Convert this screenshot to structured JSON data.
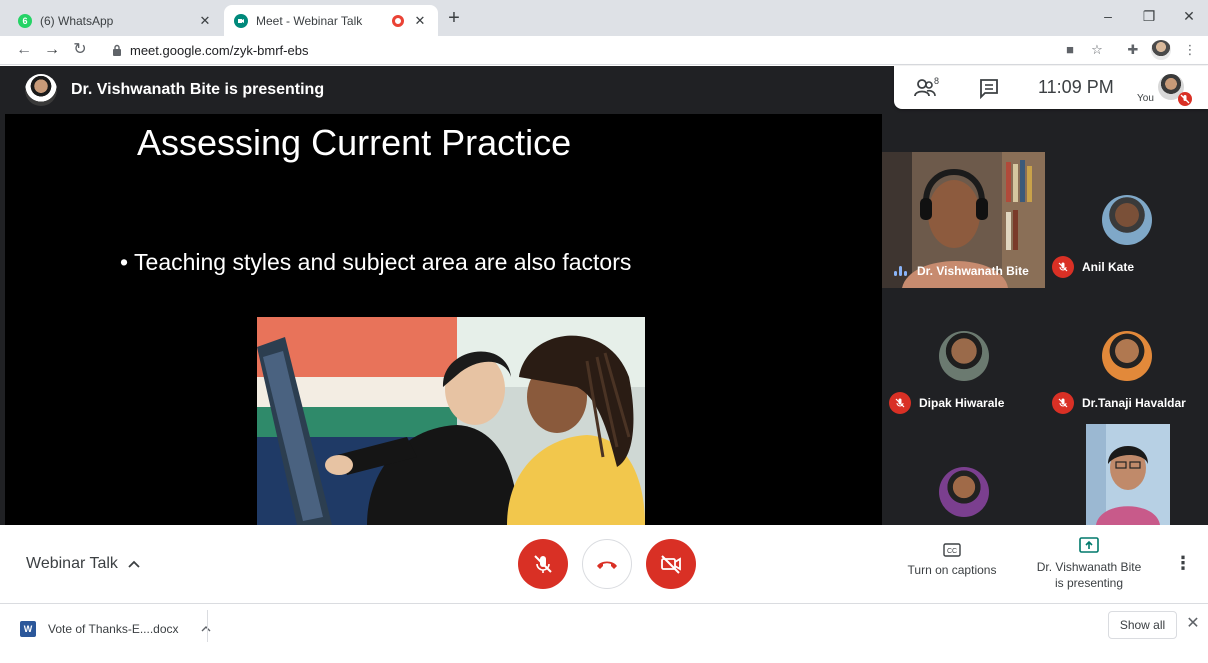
{
  "browser": {
    "tabs": [
      {
        "title": "(6) WhatsApp",
        "icon": "whatsapp-icon",
        "active": false
      },
      {
        "title": "Meet - Webinar Talk",
        "icon": "meet-icon",
        "active": true,
        "recording": true
      }
    ],
    "url": "meet.google.com/zyk-bmrf-ebs"
  },
  "presentation": {
    "presenter_banner": "Dr. Vishwanath Bite is presenting",
    "slide_title": "Assessing Current Practice",
    "slide_bullet": "• Teaching styles and subject area are also factors"
  },
  "info_card": {
    "people_count": "8",
    "time": "11:09 PM",
    "you_label": "You"
  },
  "participants": [
    {
      "name": "Dr. Vishwanath Bite",
      "muted": false,
      "speaking": true,
      "video": true
    },
    {
      "name": "Anil Kate",
      "muted": true
    },
    {
      "name": "Dipak Hiwarale",
      "muted": true
    },
    {
      "name": "Dr.Tanaji Havaldar",
      "muted": true
    },
    {
      "name": "",
      "muted": false
    },
    {
      "name": "",
      "muted": false,
      "video": true
    }
  ],
  "controls": {
    "meeting_title": "Webinar Talk",
    "captions_label": "Turn on captions",
    "presenting_label_1": "Dr. Vishwanath Bite",
    "presenting_label_2": "is presenting"
  },
  "download": {
    "file_name": "Vote of Thanks-E....docx",
    "show_all": "Show all"
  },
  "colors": {
    "meet_red": "#d93025",
    "meet_dark": "#202124",
    "tile_bg": "#3c4043",
    "speaking_blue": "#8ab4f8"
  }
}
